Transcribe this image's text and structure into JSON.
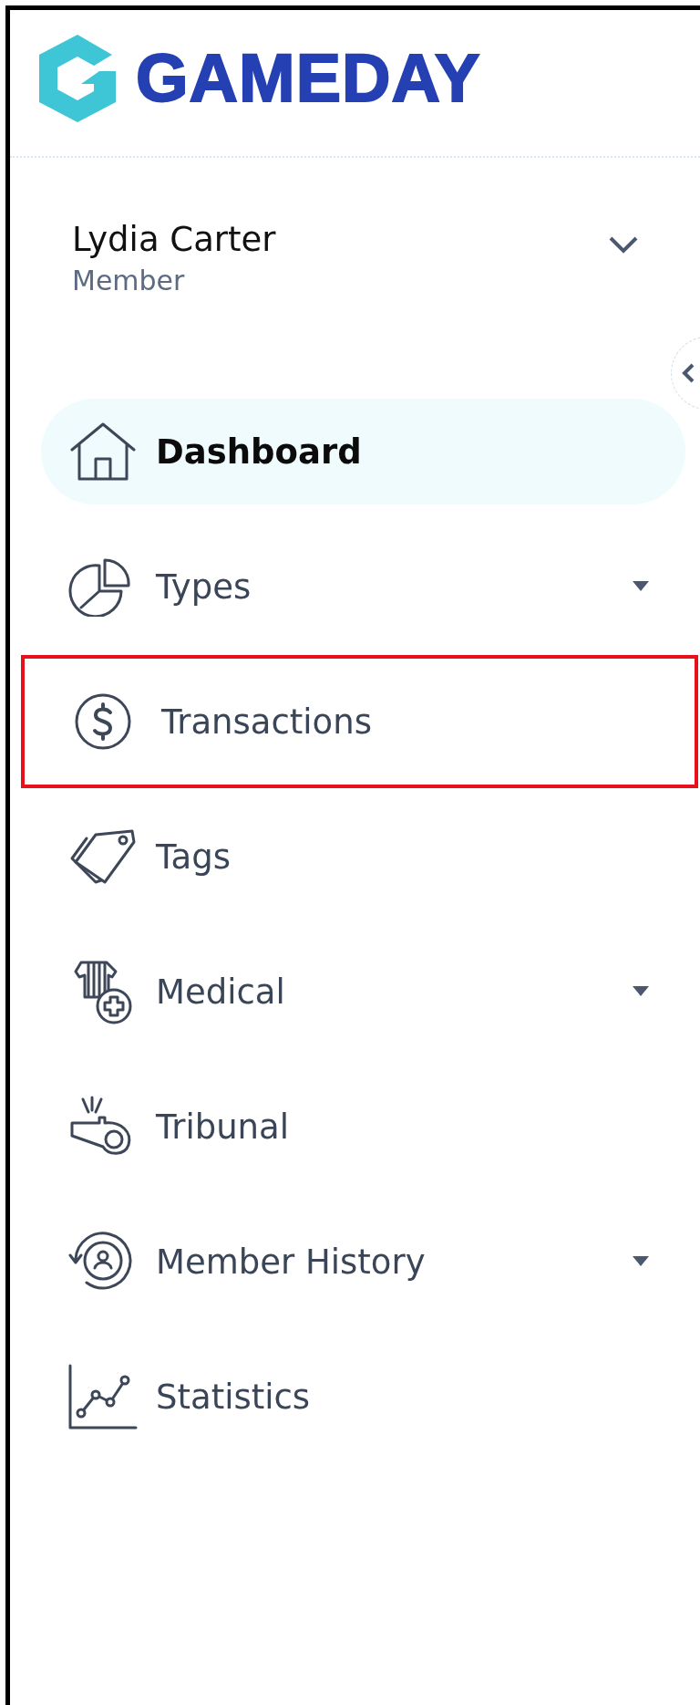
{
  "logo": {
    "text": "GAMEDAY"
  },
  "user": {
    "name": "Lydia Carter",
    "role": "Member",
    "expanded": false
  },
  "nav": [
    {
      "label": "Dashboard",
      "selected": true,
      "has_submenu": false,
      "highlighted": false
    },
    {
      "label": "Types",
      "selected": false,
      "has_submenu": true,
      "highlighted": false
    },
    {
      "label": "Transactions",
      "selected": false,
      "has_submenu": false,
      "highlighted": true
    },
    {
      "label": "Tags",
      "selected": false,
      "has_submenu": false,
      "highlighted": false
    },
    {
      "label": "Medical",
      "selected": false,
      "has_submenu": true,
      "highlighted": false
    },
    {
      "label": "Tribunal",
      "selected": false,
      "has_submenu": false,
      "highlighted": false
    },
    {
      "label": "Member History",
      "selected": false,
      "has_submenu": true,
      "highlighted": false
    },
    {
      "label": "Statistics",
      "selected": false,
      "has_submenu": false,
      "highlighted": false
    }
  ]
}
